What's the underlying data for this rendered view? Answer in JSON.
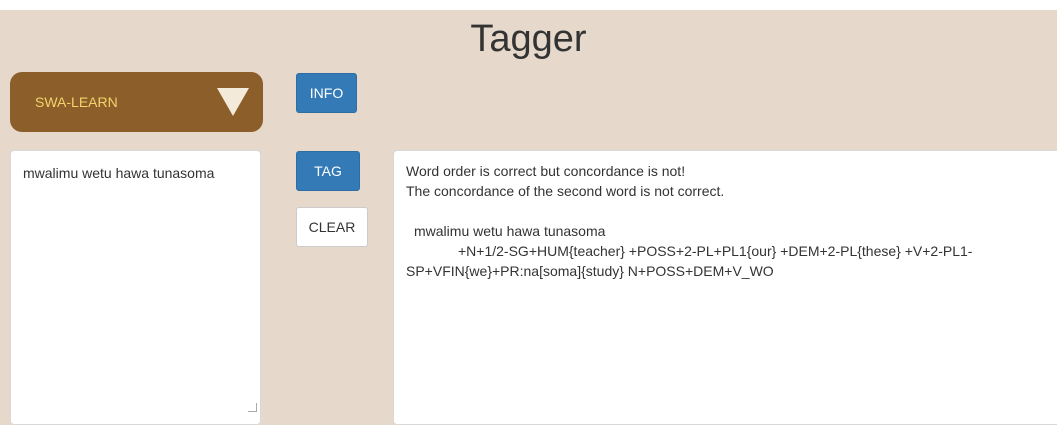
{
  "title": "Tagger",
  "language_select": {
    "selected": "SWA-LEARN"
  },
  "buttons": {
    "info": "INFO",
    "tag": "TAG",
    "clear": "CLEAR"
  },
  "input": {
    "text": "mwalimu wetu hawa tunasoma"
  },
  "output": {
    "line1": "Word order is correct but concordance is not!",
    "line2": "The concordance of the second word is not correct.",
    "sentence": "mwalimu wetu hawa tunasoma",
    "analysis": "+N+1/2-SG+HUM{teacher} +POSS+2-PL+PL1{our} +DEM+2-PL{these} +V+2-PL1-SP+VFIN{we}+PR:na[soma]{study} N+POSS+DEM+V_WO"
  },
  "colors": {
    "background": "#e6d9cb",
    "select_bg": "#8c5e2a",
    "select_text": "#f3d36b",
    "primary_button": "#337ab7"
  },
  "icons": {
    "dropdown": "chevron-down-icon"
  }
}
